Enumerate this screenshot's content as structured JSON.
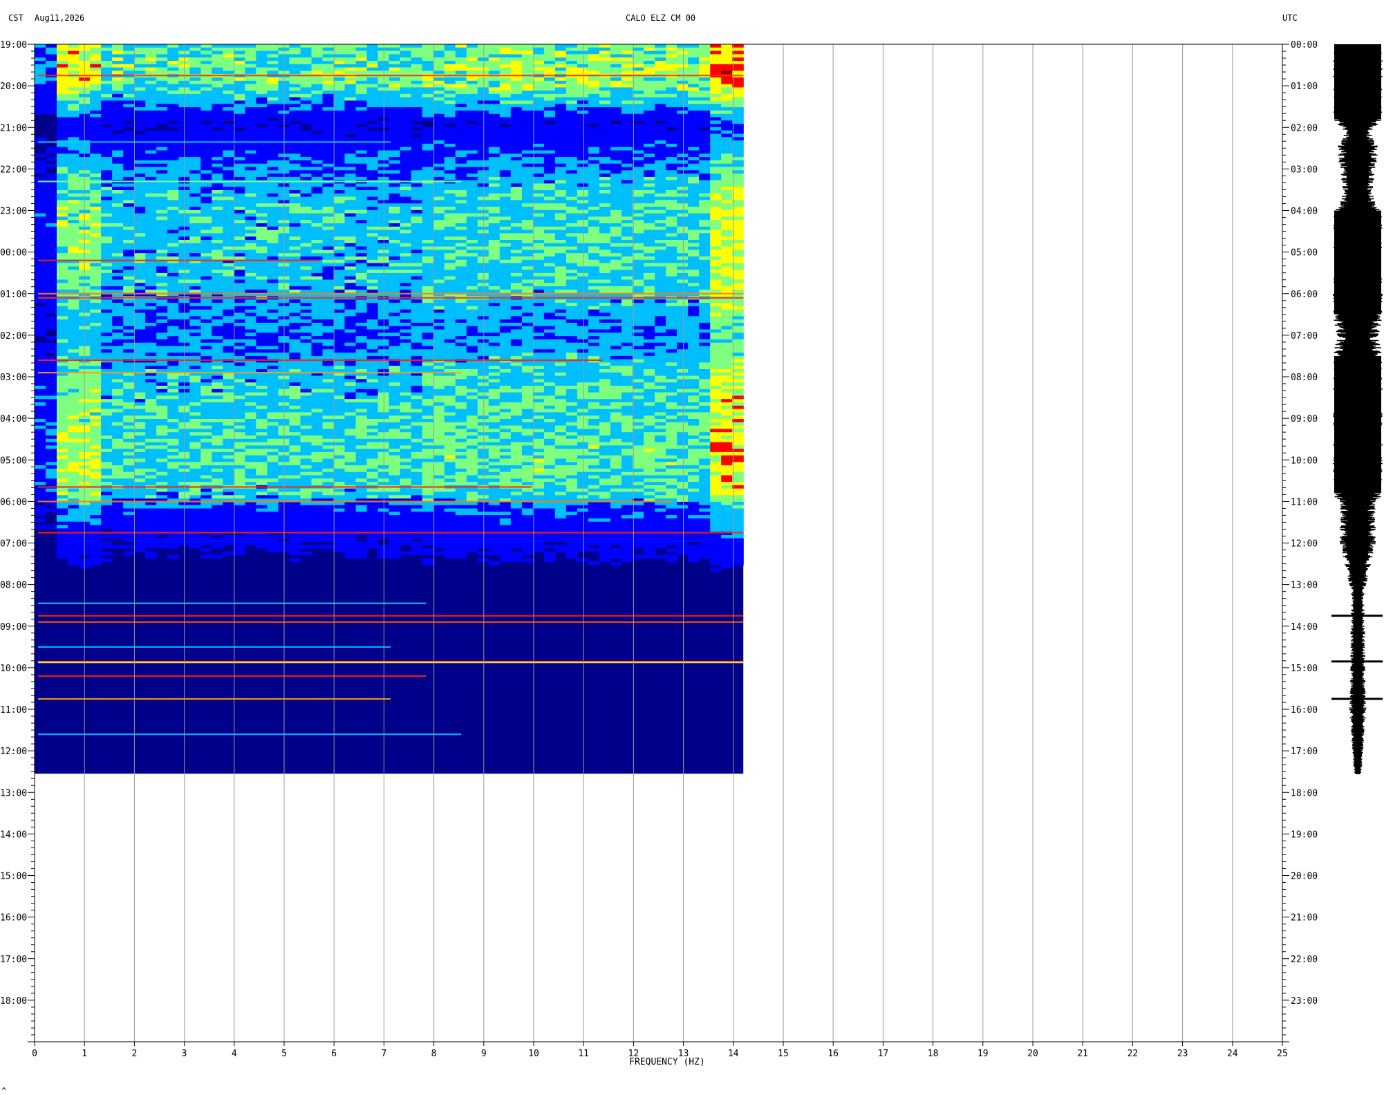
{
  "header": {
    "timezone_left": "CST",
    "date": "Aug11,2026",
    "station": "CALO ELZ CM 00",
    "timezone_right": "UTC"
  },
  "chart_data": {
    "type": "heatmap",
    "title": "CALO ELZ CM 00",
    "xlabel": "FREQUENCY (HZ)",
    "xlim": [
      0,
      25
    ],
    "x_ticks": [
      0,
      1,
      2,
      3,
      4,
      5,
      6,
      7,
      8,
      9,
      10,
      11,
      12,
      13,
      14,
      15,
      16,
      17,
      18,
      19,
      20,
      21,
      22,
      23,
      24,
      25
    ],
    "x_tick_labels": [
      "0",
      "1",
      "2",
      "3",
      "4",
      "5",
      "6",
      "7",
      "8",
      "9",
      "10",
      "11",
      "12",
      "13",
      "14",
      "15",
      "16",
      "17",
      "18",
      "19",
      "20",
      "21",
      "22",
      "23",
      "24",
      "25"
    ],
    "data_freq_max": 14.2,
    "y_left_label": "CST",
    "y_right_label": "UTC",
    "y_left_ticks": [
      "19:00",
      "20:00",
      "21:00",
      "22:00",
      "23:00",
      "00:00",
      "01:00",
      "02:00",
      "03:00",
      "04:00",
      "05:00",
      "06:00",
      "07:00",
      "08:00",
      "09:00",
      "10:00",
      "11:00",
      "12:00",
      "13:00",
      "14:00",
      "15:00",
      "16:00",
      "17:00",
      "18:00"
    ],
    "y_right_ticks": [
      "00:00",
      "01:00",
      "02:00",
      "03:00",
      "04:00",
      "05:00",
      "06:00",
      "07:00",
      "08:00",
      "09:00",
      "10:00",
      "11:00",
      "12:00",
      "13:00",
      "14:00",
      "15:00",
      "16:00",
      "17:00",
      "18:00",
      "19:00",
      "20:00",
      "21:00",
      "22:00",
      "23:00"
    ],
    "hours_total": 24,
    "data_end_hour": 17.55,
    "colormap": [
      "#00008b",
      "#0000ff",
      "#00bfff",
      "#7fff7f",
      "#ffff00",
      "#ff0000",
      "#8b0000"
    ],
    "energy_profile": [
      {
        "hour": 0.0,
        "level": 0.55
      },
      {
        "hour": 0.5,
        "level": 0.62
      },
      {
        "hour": 1.0,
        "level": 0.58
      },
      {
        "hour": 1.9,
        "level": 0.2
      },
      {
        "hour": 2.5,
        "level": 0.3
      },
      {
        "hour": 3.3,
        "level": 0.42
      },
      {
        "hour": 4.0,
        "level": 0.5
      },
      {
        "hour": 5.0,
        "level": 0.48
      },
      {
        "hour": 6.0,
        "level": 0.45
      },
      {
        "hour": 7.0,
        "level": 0.35
      },
      {
        "hour": 8.0,
        "level": 0.48
      },
      {
        "hour": 9.0,
        "level": 0.52
      },
      {
        "hour": 10.0,
        "level": 0.55
      },
      {
        "hour": 10.8,
        "level": 0.5
      },
      {
        "hour": 11.2,
        "level": 0.3
      },
      {
        "hour": 12.0,
        "level": 0.22
      },
      {
        "hour": 12.8,
        "level": 0.08
      },
      {
        "hour": 13.5,
        "level": 0.04
      },
      {
        "hour": 17.55,
        "level": 0.03
      }
    ],
    "event_lines": [
      {
        "hour": 0.75,
        "color": "#ff3000",
        "extent": 1.0
      },
      {
        "hour": 2.35,
        "color": "#00d0ff",
        "extent": 0.5
      },
      {
        "hour": 3.3,
        "color": "#80ff80",
        "extent": 0.6
      },
      {
        "hour": 5.2,
        "color": "#ff2000",
        "extent": 0.4
      },
      {
        "hour": 6.0,
        "color": "#ff8000",
        "extent": 1.0
      },
      {
        "hour": 6.1,
        "color": "#ff3000",
        "extent": 1.0
      },
      {
        "hour": 7.6,
        "color": "#ff2000",
        "extent": 0.8
      },
      {
        "hour": 7.9,
        "color": "#ffa000",
        "extent": 0.6
      },
      {
        "hour": 10.65,
        "color": "#ff2000",
        "extent": 0.7
      },
      {
        "hour": 11.0,
        "color": "#ff8000",
        "extent": 0.9
      },
      {
        "hour": 11.75,
        "color": "#ff2000",
        "extent": 1.0
      },
      {
        "hour": 13.45,
        "color": "#00d0ff",
        "extent": 0.55
      },
      {
        "hour": 13.75,
        "color": "#ff2000",
        "extent": 1.0
      },
      {
        "hour": 13.9,
        "color": "#ff5000",
        "extent": 1.0
      },
      {
        "hour": 14.5,
        "color": "#00c0ff",
        "extent": 0.5
      },
      {
        "hour": 14.85,
        "color": "#ff3000",
        "extent": 1.0
      },
      {
        "hour": 14.87,
        "color": "#ffff40",
        "extent": 1.0
      },
      {
        "hour": 15.2,
        "color": "#ff2000",
        "extent": 0.55
      },
      {
        "hour": 15.75,
        "color": "#ffa000",
        "extent": 0.5
      },
      {
        "hour": 16.6,
        "color": "#00c0ff",
        "extent": 0.6
      }
    ],
    "waveform_envelope": [
      {
        "hour": 0.0,
        "amp": 1.0
      },
      {
        "hour": 1.8,
        "amp": 1.0
      },
      {
        "hour": 2.1,
        "amp": 0.55
      },
      {
        "hour": 2.5,
        "amp": 0.85
      },
      {
        "hour": 3.1,
        "amp": 0.7
      },
      {
        "hour": 3.6,
        "amp": 0.6
      },
      {
        "hour": 4.0,
        "amp": 1.0
      },
      {
        "hour": 6.5,
        "amp": 1.0
      },
      {
        "hour": 7.0,
        "amp": 0.85
      },
      {
        "hour": 7.5,
        "amp": 1.0
      },
      {
        "hour": 10.8,
        "amp": 1.0
      },
      {
        "hour": 11.2,
        "amp": 0.7
      },
      {
        "hour": 12.0,
        "amp": 0.75
      },
      {
        "hour": 12.7,
        "amp": 0.45
      },
      {
        "hour": 13.3,
        "amp": 0.25
      },
      {
        "hour": 14.0,
        "amp": 0.3
      },
      {
        "hour": 15.0,
        "amp": 0.3
      },
      {
        "hour": 16.0,
        "amp": 0.35
      },
      {
        "hour": 16.8,
        "amp": 0.25
      },
      {
        "hour": 17.55,
        "amp": 0.15
      }
    ],
    "waveform_spikes": [
      13.75,
      14.85,
      15.75
    ],
    "grid": true
  },
  "footer": {
    "mark": "^"
  }
}
